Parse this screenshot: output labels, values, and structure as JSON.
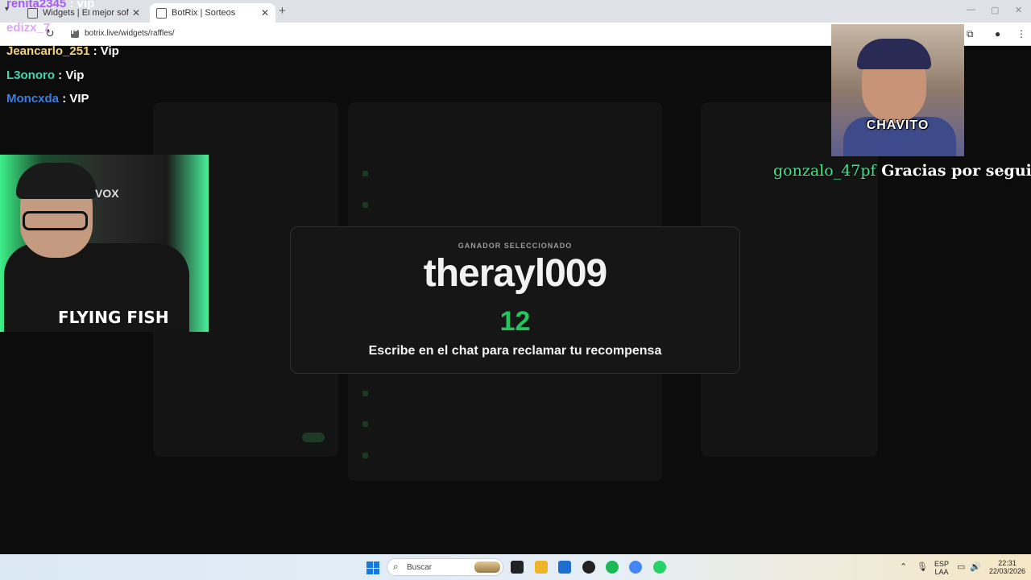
{
  "browser": {
    "tabs": [
      {
        "title": "Widgets | El mejor software pa",
        "active": false
      },
      {
        "title": "BotRix | Sorteos",
        "active": true
      }
    ],
    "url": "botrix.live/widgets/raffles/"
  },
  "chat": [
    {
      "user": "renita2345",
      "message": ": vip",
      "color": "#a55cf0"
    },
    {
      "user": "edizx_7",
      "message": ": vip",
      "color": "#d9a8f5"
    },
    {
      "user": "Jeancarlo_251",
      "message": ": Vip",
      "color": "#f2d27a"
    },
    {
      "user": "L3onoro",
      "message": ": Vip",
      "color": "#43d6b0"
    },
    {
      "user": "Moncxda",
      "message": ": VIP",
      "color": "#3d7ee0"
    }
  ],
  "webcam": {
    "shirt_text": "FLYING FISH",
    "chair_brand": "VOX"
  },
  "winner_modal": {
    "label": "GANADOR SELECCIONADO",
    "winner": "therayl009",
    "count": "12",
    "message": "Escribe en el chat para reclamar tu recompensa",
    "accent": "#22c55e"
  },
  "follow_alert": {
    "overlay_label": "CHAVITO",
    "user": "gonzalo_47pf",
    "text": "Gracias por seguirme!!"
  },
  "taskbar": {
    "search_placeholder": "Buscar",
    "lang_top": "ESP",
    "lang_bottom": "LAA",
    "time": "22:31",
    "date": "22/03/2026"
  }
}
